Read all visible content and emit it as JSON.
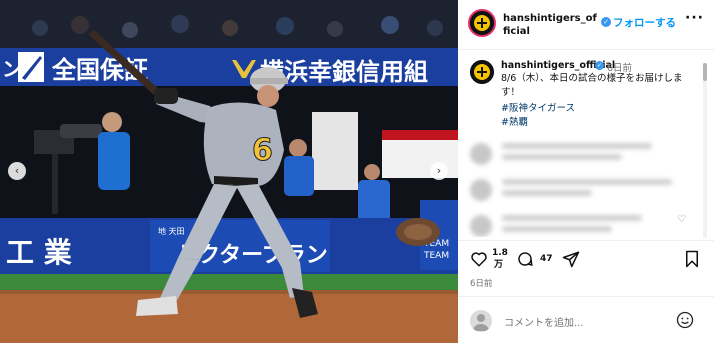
{
  "header": {
    "username": "hanshintigers_official",
    "follow_label": "フォローする",
    "more_label": "···"
  },
  "caption": {
    "username": "hanshintigers_official",
    "time": "6日前",
    "text": "8/6（木）、本日の試合の様子をお届けします！",
    "hashtags": [
      "#阪神タイガース",
      "#熱覇"
    ]
  },
  "stats": {
    "likes": "1.8\n万",
    "likes_num": "1.8",
    "likes_unit": "万",
    "comments": "47",
    "posted": "6日前"
  },
  "comment_bar": {
    "placeholder": "コメントを追加..."
  },
  "photo": {
    "banner_left": "ン",
    "banner_brand": "全国保証",
    "banner_right": "横浜幸銀信用組",
    "wall_left": "工 業",
    "wall_center": "ドクタープラン",
    "wall_small": "地 天田",
    "wall_right": "TEAM",
    "wall_right2": "TEAM",
    "jersey": "6"
  },
  "colors": {
    "accent": "#0095f6",
    "hashtag": "#00376b",
    "banner_blue": "#1b3f9e"
  }
}
